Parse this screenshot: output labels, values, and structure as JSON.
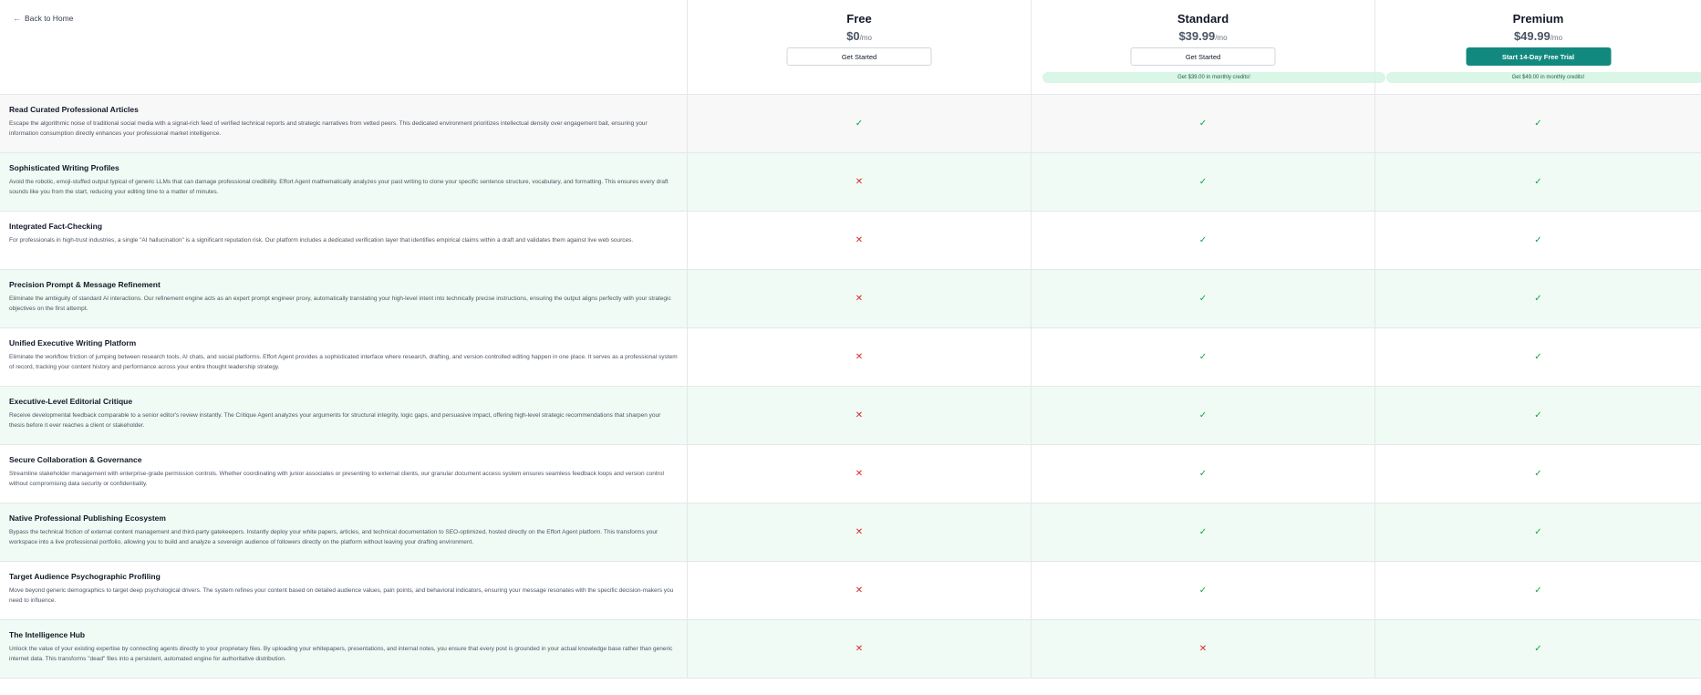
{
  "nav": {
    "back_label": "Back to Home"
  },
  "plans": [
    {
      "name": "Free",
      "price": "$0",
      "per": "/mo",
      "cta": "Get Started",
      "credit": ""
    },
    {
      "name": "Standard",
      "price": "$39.99",
      "per": "/mo",
      "cta": "Get Started",
      "credit": "Get $39.00 in monthly credits!"
    },
    {
      "name": "Premium",
      "price": "$49.99",
      "per": "/mo",
      "cta": "Start 14-Day Free Trial",
      "credit": "Get $49.00 in monthly credits!"
    }
  ],
  "features": [
    {
      "title": "Read Curated Professional Articles",
      "desc": "Escape the algorithmic noise of traditional social media with a signal-rich feed of verified technical reports and strategic narratives from vetted peers. This dedicated environment prioritizes intellectual density over engagement bait, ensuring your information consumption directly enhances your professional market intelligence.",
      "free": true,
      "standard": true,
      "premium": true
    },
    {
      "title": "Sophisticated Writing Profiles",
      "desc": "Avoid the robotic, emoji-stuffed output typical of generic LLMs that can damage professional credibility. Effort Agent mathematically analyzes your past writing to clone your specific sentence structure, vocabulary, and formatting. This ensures every draft sounds like you from the start, reducing your editing time to a matter of minutes.",
      "free": false,
      "standard": true,
      "premium": true
    },
    {
      "title": "Integrated Fact-Checking",
      "desc": "For professionals in high-trust industries, a single \"AI hallucination\" is a significant reputation risk. Our platform includes a dedicated verification layer that identifies empirical claims within a draft and validates them against live web sources.",
      "free": false,
      "standard": true,
      "premium": true
    },
    {
      "title": "Precision Prompt & Message Refinement",
      "desc": "Eliminate the ambiguity of standard AI interactions. Our refinement engine acts as an expert prompt engineer proxy, automatically translating your high-level intent into technically precise instructions, ensuring the output aligns perfectly with your strategic objectives on the first attempt.",
      "free": false,
      "standard": true,
      "premium": true
    },
    {
      "title": "Unified Executive Writing Platform",
      "desc": "Eliminate the workflow friction of jumping between research tools, AI chats, and social platforms. Effort Agent provides a sophisticated interface where research, drafting, and version-controlled editing happen in one place. It serves as a professional system of record, tracking your content history and performance across your entire thought leadership strategy.",
      "free": false,
      "standard": true,
      "premium": true
    },
    {
      "title": "Executive-Level Editorial Critique",
      "desc": "Receive developmental feedback comparable to a senior editor's review instantly. The Critique Agent analyzes your arguments for structural integrity, logic gaps, and persuasive impact, offering high-level strategic recommendations that sharpen your thesis before it ever reaches a client or stakeholder.",
      "free": false,
      "standard": true,
      "premium": true
    },
    {
      "title": "Secure Collaboration & Governance",
      "desc": "Streamline stakeholder management with enterprise-grade permission controls. Whether coordinating with junior associates or presenting to external clients, our granular document access system ensures seamless feedback loops and version control without compromising data security or confidentiality.",
      "free": false,
      "standard": true,
      "premium": true
    },
    {
      "title": "Native Professional Publishing Ecosystem",
      "desc": "Bypass the technical friction of external content management and third-party gatekeepers. Instantly deploy your white papers, articles, and technical documentation to SEO-optimized, hosted directly on the Effort Agent platform. This transforms your workspace into a live professional portfolio, allowing you to build and analyze a sovereign audience of followers directly on the platform without leaving your drafting environment.",
      "free": false,
      "standard": true,
      "premium": true
    },
    {
      "title": "Target Audience Psychographic Profiling",
      "desc": "Move beyond generic demographics to target deep psychological drivers. The system refines your content based on detailed audience values, pain points, and behavioral indicators, ensuring your message resonates with the specific decision-makers you need to influence.",
      "free": false,
      "standard": true,
      "premium": true
    },
    {
      "title": "The Intelligence Hub",
      "desc": "Unlock the value of your existing expertise by connecting agents directly to your proprietary files. By uploading your whitepapers, presentations, and internal notes, you ensure that every post is grounded in your actual knowledge base rather than generic internet data. This transforms \"dead\" files into a persistent, automated engine for authoritative distribution.",
      "free": false,
      "standard": false,
      "premium": true
    }
  ],
  "icons": {
    "check": "check-icon",
    "cross": "cross-icon",
    "back": "arrow-left-icon"
  },
  "colors": {
    "accent": "#12897f",
    "check": "#16a34a",
    "cross": "#dc2626",
    "credit_bg": "#d9f6e6",
    "row_alt": "#effbf4"
  }
}
